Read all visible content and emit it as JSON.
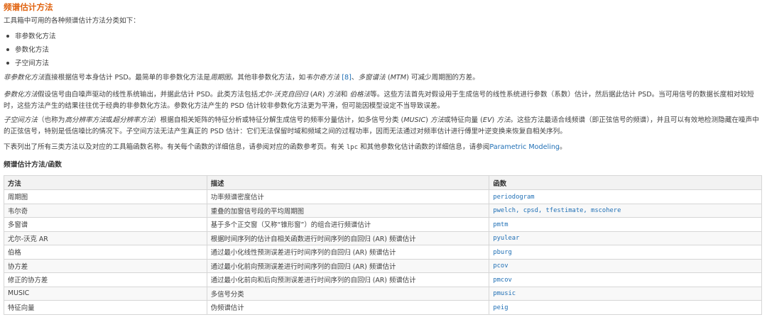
{
  "section_title": "频谱估计方法",
  "intro": "工具箱中可用的各种频谱估计方法分类如下：",
  "categories": [
    "非参数化方法",
    "参数化方法",
    "子空间方法"
  ],
  "nonparam": {
    "term": "非参数化方法",
    "t1": "直接根据信号本身估计 PSD。最简单的非参数化方法是",
    "periodogram_em": "周期图",
    "t2": "。其他非参数化方法，如",
    "welch_em": "韦尔奇方法",
    "ref": "[8]",
    "t3": "、",
    "mtm_em": "多窗谱法",
    "t4": " (",
    "mtm_abbr": "MTM",
    "t5": ") 可减少周期图的方差。"
  },
  "param": {
    "term": "参数化方法",
    "t1": "假设信号由白噪声驱动的线性系统输出，并据此估计 PSD。此类方法包括",
    "yw_em": "尤尔-沃克自回归",
    "t2": " (",
    "ar_abbr": "AR",
    "t3": ") ",
    "method_em": "方法",
    "t4": "和 ",
    "burg_em": "伯格法",
    "t5": "等。这些方法首先对假设用于生成信号的线性系统进行参数（系数）估计，然后据此估计 PSD。当可用信号的数据长度相对较短时，这些方法产生的结果往往优于经典的非参数化方法。参数化方法产生的 PSD 估计较非参数化方法更为平滑，但可能因模型设定不当导致误差。"
  },
  "subspace": {
    "term": "子空间方法",
    "t1": "（也称为",
    "hr_em": "高分辨率方法",
    "t2": "或",
    "sr_em": "超分辨率方法",
    "t3": "）根据自相关矩阵的特征分析或特征分解生成信号的频率分量估计，如多信号分类 (",
    "music_em": "MUSIC",
    "t4": ") ",
    "method_em": "方法",
    "t5": "或特征向量 (",
    "ev_em": "EV",
    "t6": ") ",
    "method2_em": "方法",
    "t7": "。这些方法最适合线频谱（即正弦信号的频谱），并且可以有效地检测隐藏在噪声中的正弦信号，特别是低信噪比的情况下。子空间方法无法产生真正的 PSD 估计：它们无法保留时域和频域之间的过程功率，因而无法通过对频率估计进行傅里叶逆变换来恢复自相关序列。"
  },
  "list_note": {
    "t1": "下表列出了所有三类方法以及对应的工具箱函数名称。有关每个函数的详细信息，请参阅对应的函数参考页。有关 ",
    "lpc": "lpc",
    "t2": " 和其他参数化估计函数的详细信息，请参阅",
    "link": "Parametric Modeling",
    "t3": "。"
  },
  "table_title": "频谱估计方法/函数",
  "table": {
    "headers": [
      "方法",
      "描述",
      "函数"
    ],
    "rows": [
      {
        "method": "周期图",
        "desc": "功率频谱密度估计",
        "func": "periodogram"
      },
      {
        "method": "韦尔奇",
        "desc": "重叠的加窗信号段的平均周期图",
        "func": "pwelch, cpsd, tfestimate, mscohere"
      },
      {
        "method": "多窗谱",
        "desc": "基于多个正交窗（又称“锥形窗”）的组合进行频谱估计",
        "func": "pmtm"
      },
      {
        "method": "尤尔-沃克 AR",
        "desc": "根据时间序列的估计自相关函数进行时间序列的自回归 (AR) 频谱估计",
        "func": "pyulear"
      },
      {
        "method": "伯格",
        "desc": "通过最小化线性预测误差进行时间序列的自回归 (AR) 频谱估计",
        "func": "pburg"
      },
      {
        "method": "协方差",
        "desc": "通过最小化前向预测误差进行时间序列的自回归 (AR) 频谱估计",
        "func": "pcov"
      },
      {
        "method": "修正的协方差",
        "desc": "通过最小化前向和后向预测误差进行时间序列的自回归 (AR) 频谱估计",
        "func": "pmcov"
      },
      {
        "method": "MUSIC",
        "desc": "多信号分类",
        "func": "pmusic"
      },
      {
        "method": "特征向量",
        "desc": "伪频谱估计",
        "func": "peig"
      }
    ]
  },
  "colors": {
    "title": "#e06310",
    "link": "#1f6fb5"
  }
}
